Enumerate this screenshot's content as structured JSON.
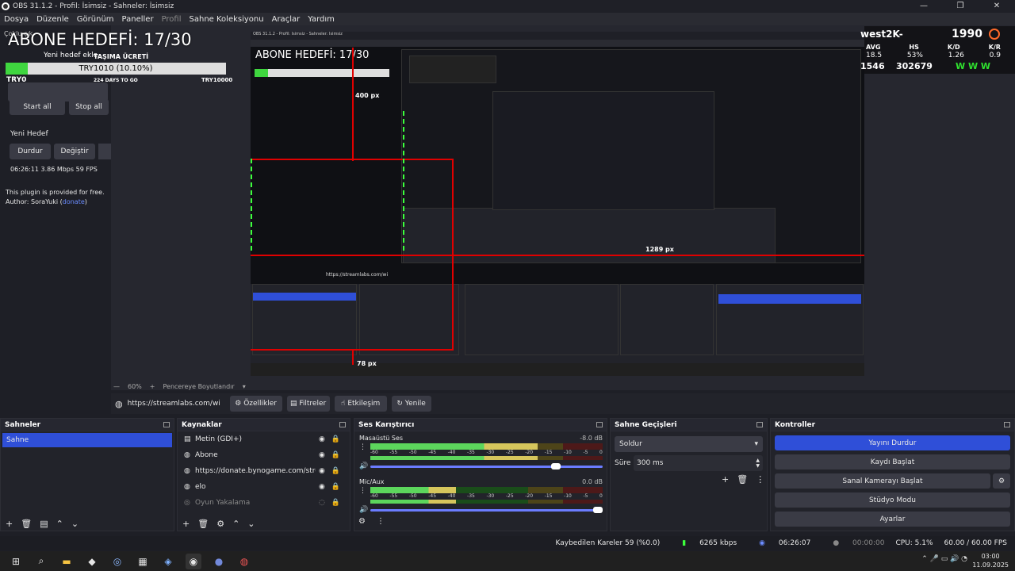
{
  "window": {
    "title": "OBS 31.1.2 - Profil: İsimsiz - Sahneler: İsimsiz",
    "controls": [
      "—",
      "❐",
      "✕"
    ]
  },
  "menu": [
    "Dosya",
    "Düzenle",
    "Görünüm",
    "Paneller",
    "Profil",
    "Sahne Koleksiyonu",
    "Araçlar",
    "Yardım"
  ],
  "left_dock": {
    "title": "Çoklu çık",
    "overlay_title": "ABONE HEDEFİ: 17/30",
    "subtitle": "Yeni hedef ekle",
    "donation_title": "TAŞIMA ÜCRETİ",
    "donation_progress_text": "TRY1010 (10.10%)",
    "donation_progress": 0.101,
    "donation_left": "TRY0",
    "donation_right": "TRY10000",
    "donation_days": "224 DAYS TO GO",
    "start_all": "Start all",
    "stop_all": "Stop all",
    "yeni_hedef": "Yeni Hedef",
    "durdur": "Durdur",
    "degistir": "Değiştir",
    "stats": "06:26:11  3.86 Mbps  59 FPS",
    "plugin_note": "This plugin is provided for free.",
    "author_prefix": "Author: SoraYuki (",
    "author_link": "donate",
    "author_suffix": ")"
  },
  "preview": {
    "inner_title": "ABONE HEDEFİ: 17/30",
    "measure_400": "400 px",
    "measure_78": "78 px",
    "measure_1289": "1289 px",
    "inner_url": "https://streamlabs.com/wi"
  },
  "hud": {
    "name": "west2K-",
    "score": "1990",
    "avg_label": "AVG",
    "hs_label": "HS",
    "kd_label": "K/D",
    "kr_label": "K/R",
    "avg": "18.5",
    "hs": "53%",
    "kd": "1.26",
    "kr": "0.9",
    "stat_a": "1546",
    "stat_b": "302679",
    "wins": "W W W"
  },
  "zoom": {
    "level": "60%",
    "minus": "—",
    "plus": "+",
    "fit": "Pencereye Boyutlandır"
  },
  "toolbar": {
    "url": "https://streamlabs.com/wi",
    "properties": "Özellikler",
    "filters": "Filtreler",
    "interact": "Etkileşim",
    "refresh": "Yenile"
  },
  "scenes": {
    "title": "Sahneler",
    "items": [
      "Sahne"
    ]
  },
  "sources": {
    "title": "Kaynaklar",
    "items": [
      {
        "name": "Metin (GDI+)",
        "icon": "text-icon"
      },
      {
        "name": "Abone",
        "icon": "globe-icon"
      },
      {
        "name": "https://donate.bynogame.com/stream",
        "icon": "globe-icon"
      },
      {
        "name": "elo",
        "icon": "globe-icon"
      },
      {
        "name": "Oyun Yakalama",
        "icon": "gamepad-icon",
        "dim": true
      }
    ]
  },
  "mixer": {
    "title": "Ses Karıştırıcı",
    "channels": [
      {
        "name": "Masaüstü Ses",
        "db": "-8.0 dB",
        "level": 0.72,
        "volume": 0.82
      },
      {
        "name": "Mic/Aux",
        "db": "0.0 dB",
        "level": 0.37,
        "volume": 1.0
      }
    ],
    "ticks": [
      "-60",
      "-55",
      "-50",
      "-45",
      "-40",
      "-35",
      "-30",
      "-25",
      "-20",
      "-15",
      "-10",
      "-5",
      "0"
    ]
  },
  "transitions": {
    "title": "Sahne Geçişleri",
    "type": "Soldur",
    "duration_label": "Süre",
    "duration": "300 ms"
  },
  "controls": {
    "title": "Kontroller",
    "stop_stream": "Yayını Durdur",
    "start_record": "Kaydı Başlat",
    "virtual_cam": "Sanal Kamerayı Başlat",
    "studio": "Stüdyo Modu",
    "settings": "Ayarlar"
  },
  "status": {
    "dropped": "Kaybedilen Kareler 59 (%0.0)",
    "bitrate": "6265 kbps",
    "stream_time": "06:26:07",
    "rec_time": "00:00:00",
    "cpu": "CPU: 5.1%",
    "fps": "60.00 / 60.00 FPS"
  },
  "taskbar": {
    "time": "03:00",
    "date": "11.09.2025"
  },
  "colors": {
    "accent": "#2f4fd8",
    "bg": "#1e1f26",
    "red_guide": "#e00000",
    "green_guide": "#3cff3c"
  }
}
